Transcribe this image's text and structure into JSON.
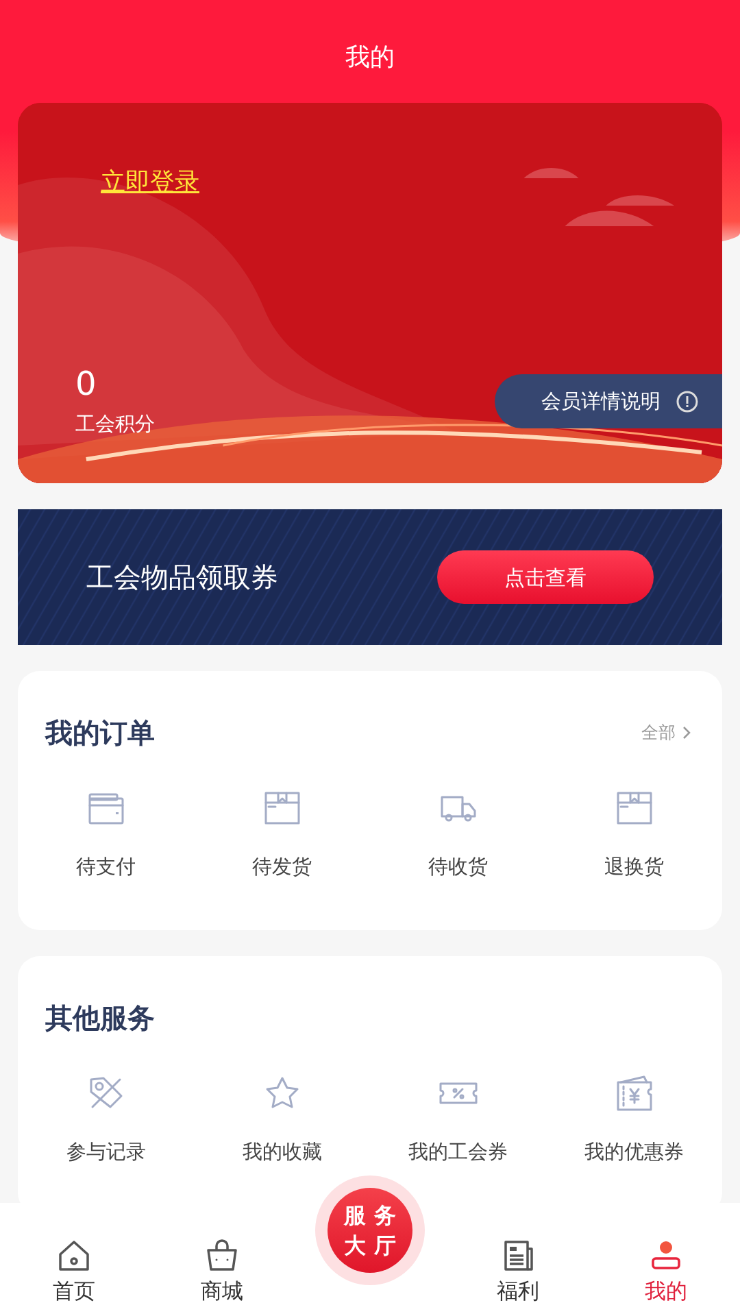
{
  "header": {
    "title": "我的"
  },
  "member_card": {
    "login_link": "立即登录",
    "points": "0",
    "points_label": "工会积分",
    "details_button": "会员详情说明"
  },
  "coupon_banner": {
    "title": "工会物品领取券",
    "button": "点击查看"
  },
  "orders": {
    "title": "我的订单",
    "all_link": "全部",
    "items": [
      {
        "label": "待支付",
        "kind": "wallet"
      },
      {
        "label": "待发货",
        "kind": "box"
      },
      {
        "label": "待收货",
        "kind": "truck"
      },
      {
        "label": "退换货",
        "kind": "box"
      }
    ]
  },
  "services": {
    "title": "其他服务",
    "items": [
      {
        "label": "参与记录",
        "kind": "tag"
      },
      {
        "label": "我的收藏",
        "kind": "star"
      },
      {
        "label": "我的工会券",
        "kind": "ticket"
      },
      {
        "label": "我的优惠券",
        "kind": "coupon"
      }
    ]
  },
  "tab_bar": [
    {
      "kind": "tab",
      "label": "首页",
      "selected": false
    },
    {
      "kind": "tab",
      "label": "商城",
      "selected": false
    },
    {
      "kind": "center",
      "chars": [
        "服",
        "务",
        "大",
        "厅"
      ],
      "selected": false
    },
    {
      "kind": "tab",
      "label": "福利",
      "selected": false
    },
    {
      "kind": "tab",
      "label": "我的",
      "selected": true
    }
  ]
}
